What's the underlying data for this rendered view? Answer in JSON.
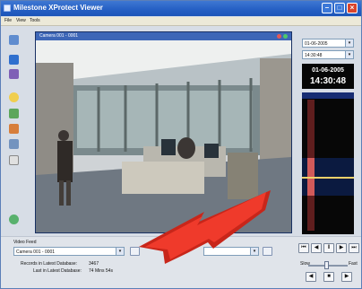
{
  "window": {
    "title": "Milestone XProtect Viewer"
  },
  "menu": {
    "items": [
      "File",
      "View",
      "Tools"
    ]
  },
  "video": {
    "camera_label": "Camera 001 - 0001"
  },
  "right_panel": {
    "date_value": "01-06-2005",
    "time_value": "14:30:48",
    "clock_date": "01-06-2005",
    "clock_time": "14:30:48"
  },
  "bottom_panel": {
    "video_feed_label": "Video Feed",
    "camera_select_value": "Camera 001 - 0001",
    "records_label": "Records in Latest Database:",
    "records_value": "3467",
    "last_label": "Last in Latest Database:",
    "last_value": "74 Mins 54s",
    "slow_label": "Slow",
    "fast_label": "Fast"
  },
  "colors": {
    "title_bar": "#245ec3",
    "video_header": "#3d66b7",
    "arrow": "#e32d1f",
    "timeline_active": "#d15a5a"
  },
  "icons": {
    "toolbar": [
      "camera-icon",
      "monitor-icon",
      "person-icon",
      "info-icon",
      "image-icon",
      "tools-icon",
      "settings-icon",
      "help-icon"
    ],
    "transport": [
      "skip-back-icon",
      "step-back-icon",
      "pause-icon",
      "step-forward-icon",
      "skip-forward-icon",
      "play-back-icon",
      "stop-icon",
      "play-forward-icon"
    ]
  }
}
